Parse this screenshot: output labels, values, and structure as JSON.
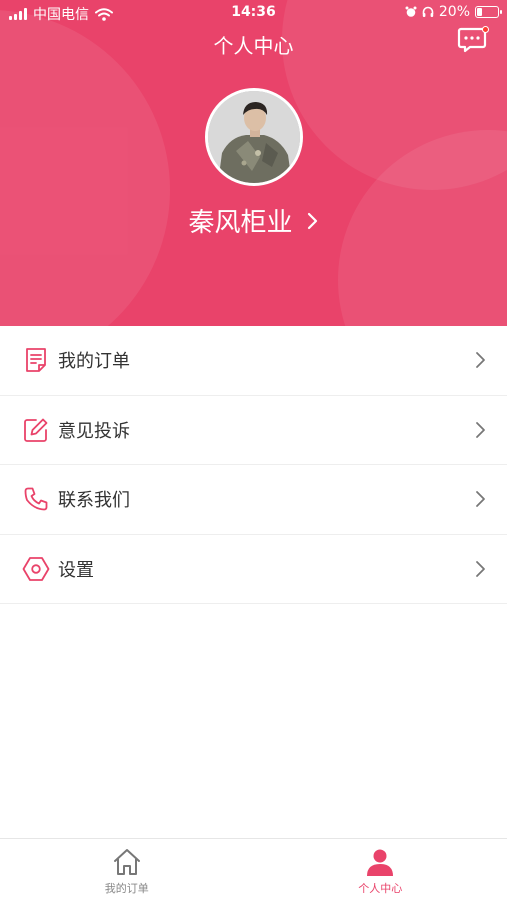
{
  "status_bar": {
    "carrier": "中国电信",
    "time": "14:36",
    "battery_percent": "20%"
  },
  "header": {
    "title": "个人中心",
    "username": "秦风柜业",
    "accent_color": "#e9436a"
  },
  "menu": {
    "items": [
      {
        "label": "我的订单",
        "icon": "order-document-icon"
      },
      {
        "label": "意见投诉",
        "icon": "edit-feedback-icon"
      },
      {
        "label": "联系我们",
        "icon": "phone-icon"
      },
      {
        "label": "设置",
        "icon": "settings-hexagon-icon"
      }
    ]
  },
  "tabbar": {
    "tabs": [
      {
        "label": "我的订单",
        "icon": "home-icon",
        "active": false
      },
      {
        "label": "个人中心",
        "icon": "person-icon",
        "active": true
      }
    ]
  }
}
